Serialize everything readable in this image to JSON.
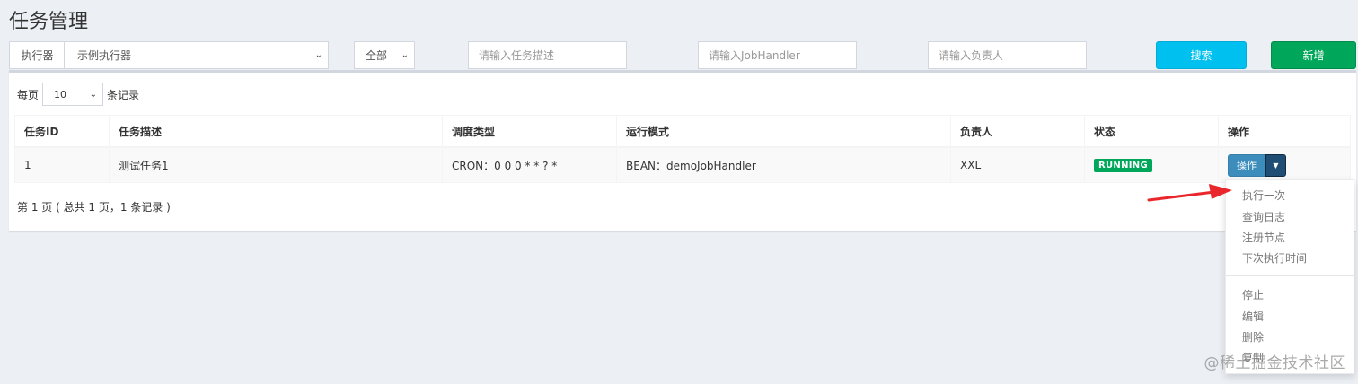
{
  "page": {
    "title": "任务管理"
  },
  "filters": {
    "executor_label": "执行器",
    "executor_value": "示例执行器",
    "status_value": "全部",
    "desc_placeholder": "请输入任务描述",
    "handler_placeholder": "请输入JobHandler",
    "author_placeholder": "请输入负责人",
    "search_label": "搜索",
    "add_label": "新增"
  },
  "colors": {
    "search": "#00c0ef",
    "add": "#00a65a",
    "running": "#00a65a",
    "op": "#3c8dbc",
    "arrow": "#e8262b"
  },
  "length": {
    "prefix": "每页",
    "value": "10",
    "suffix": "条记录"
  },
  "table": {
    "headers": [
      "任务ID",
      "任务描述",
      "调度类型",
      "运行模式",
      "负责人",
      "状态",
      "操作"
    ],
    "rows": [
      {
        "id": "1",
        "desc": "测试任务1",
        "schedule": "CRON：0 0 0 * * ? *",
        "mode": "BEAN：demoJobHandler",
        "author": "XXL",
        "status": "RUNNING",
        "op": "操作"
      }
    ]
  },
  "page_info": "第 1 页 ( 总共 1 页，1 条记录 )",
  "dropdown": {
    "group1": [
      "执行一次",
      "查询日志",
      "注册节点",
      "下次执行时间"
    ],
    "group2": [
      "停止",
      "编辑",
      "删除",
      "复制"
    ]
  },
  "watermark": "@稀土掘金技术社区"
}
